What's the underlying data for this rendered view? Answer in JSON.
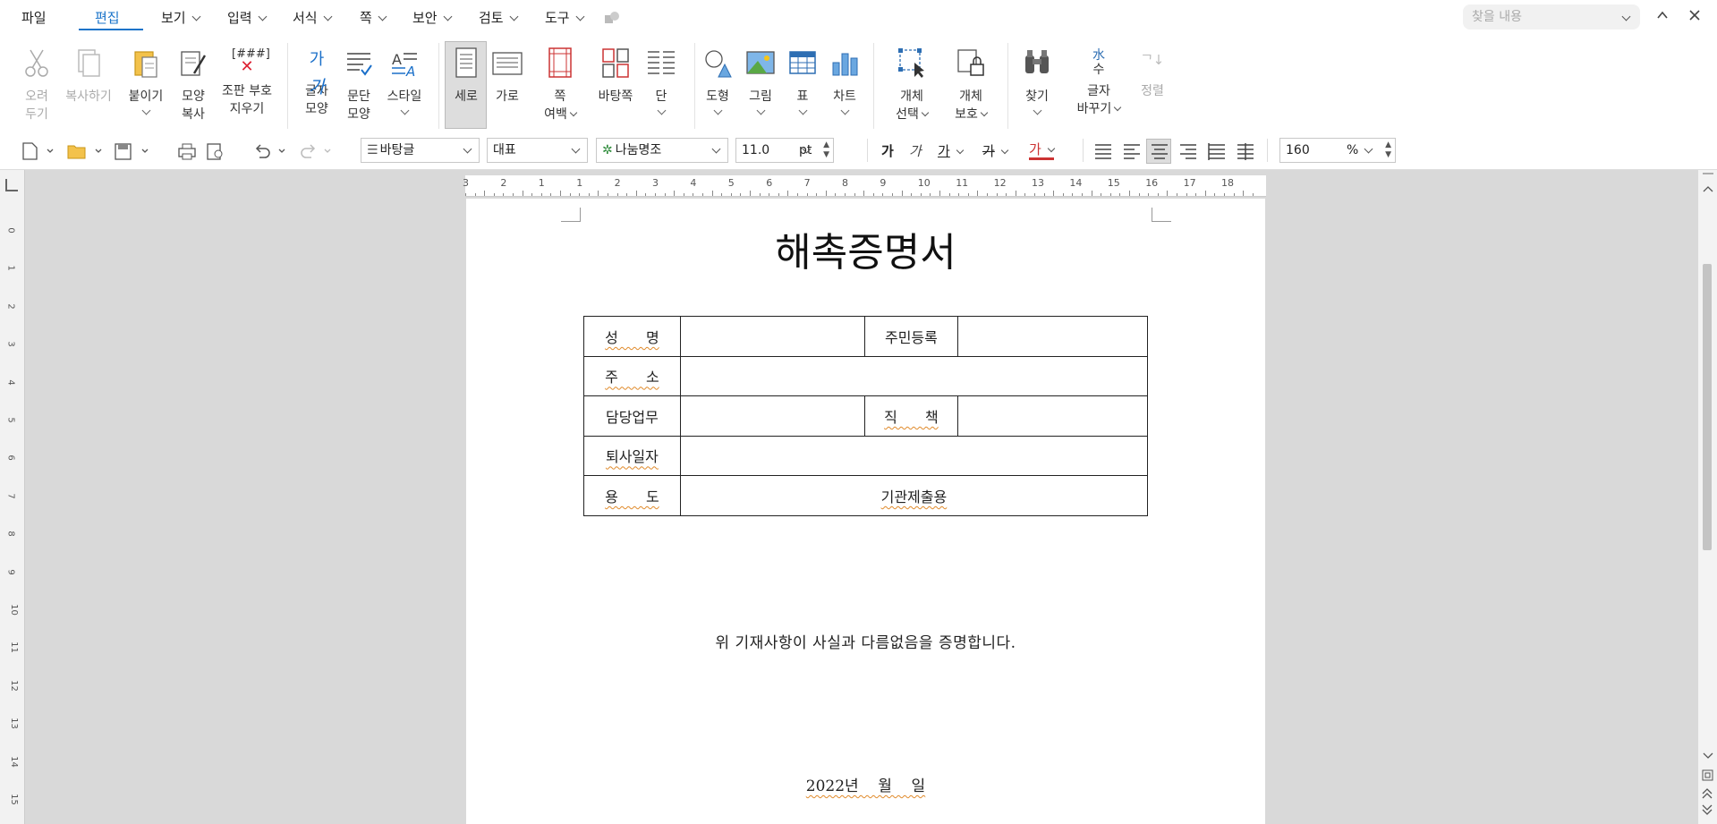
{
  "menu": {
    "file": "파일",
    "tabs": [
      "편집",
      "보기",
      "입력",
      "서식",
      "쪽",
      "보안",
      "검토",
      "도구"
    ],
    "search_placeholder": "찾을 내용"
  },
  "ribbon": {
    "cut": [
      "오려",
      "두기"
    ],
    "copy": "복사하기",
    "paste": "붙이기",
    "format_copy": [
      "모양",
      "복사"
    ],
    "clear_codes": [
      "조판 부호",
      "지우기"
    ],
    "clear_codes_icon_text": "[###]",
    "char_shape": [
      "글자",
      "모양"
    ],
    "para_shape": [
      "문단",
      "모양"
    ],
    "style": "스타일",
    "portrait": "세로",
    "landscape": "가로",
    "page_margin": [
      "쪽",
      "여백"
    ],
    "background": "바탕쪽",
    "columns": "단",
    "shapes": "도형",
    "picture": "그림",
    "table": "표",
    "chart": "차트",
    "object_select": [
      "개체",
      "선택"
    ],
    "object_protect": [
      "개체",
      "보호"
    ],
    "find": "찾기",
    "char_convert": [
      "글자",
      "바꾸기"
    ],
    "char_convert_icon": [
      "水",
      "수"
    ],
    "sort": "정렬"
  },
  "toolbar": {
    "style_value": "바탕글",
    "font_group": "대표",
    "font_name": "나눔명조",
    "font_size": "11.0",
    "font_unit": "pt",
    "zoom": "160",
    "zoom_unit": "%",
    "char_icons": [
      "가",
      "가",
      "가",
      "가",
      "가"
    ]
  },
  "ruler": {
    "h_ticks": [
      "3",
      "2",
      "1",
      "1",
      "2",
      "3",
      "4",
      "5",
      "6",
      "7",
      "8",
      "9",
      "10",
      "11",
      "12",
      "13",
      "14",
      "15",
      "16",
      "17",
      "18"
    ],
    "v_ticks": [
      "0",
      "1",
      "2",
      "3",
      "4",
      "5",
      "6",
      "7",
      "8",
      "9",
      "10",
      "11",
      "12",
      "13",
      "14",
      "15"
    ]
  },
  "document": {
    "title": "해촉증명서",
    "table": {
      "name_label": "성  명",
      "resident_label": "주민등록",
      "address_label": "주  소",
      "duty_label": "담당업무",
      "position_label": "직  책",
      "retire_label": "퇴사일자",
      "purpose_label": "용  도",
      "purpose_value": "기관제출용"
    },
    "statement": "위 기재사항이 사실과 다름없음을 증명합니다.",
    "date": "2022년    월    일"
  },
  "colors": {
    "accent": "#1a73c9",
    "workspace": "#d9d9d9"
  }
}
